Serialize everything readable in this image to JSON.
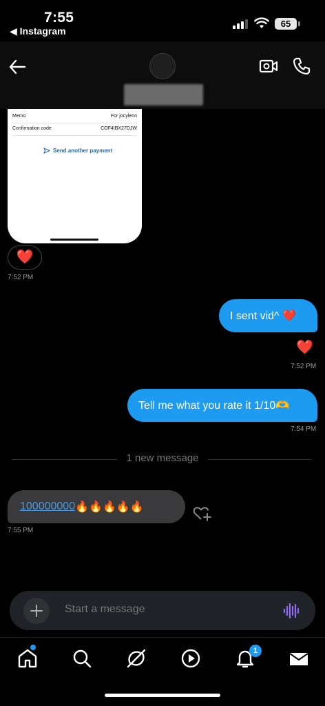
{
  "status_bar": {
    "time": "7:55",
    "back_app": "◀ Instagram",
    "battery": "65"
  },
  "header": {
    "icons": [
      "back-arrow-icon",
      "video-camera-icon",
      "phone-icon"
    ]
  },
  "shared_card": {
    "rows": [
      {
        "label": "Memo",
        "value": "For jocylenn"
      },
      {
        "label": "Confirmation code",
        "value": "COF4IBX27DJW"
      }
    ],
    "action": "Send another payment"
  },
  "messages": {
    "card_reaction": "❤️",
    "card_time": "7:52 PM",
    "sent_1": "I sent vid^ ❤️",
    "heart_reaction": "❤️",
    "sent_1_time": "7:52 PM",
    "sent_2": "Tell me what you rate it 1/10🫶",
    "sent_2_time": "7:54 PM",
    "new_divider": "1 new message",
    "recv_link": "100000000",
    "recv_emoji": "🔥🔥🔥🔥🔥",
    "recv_time": "7:55 PM"
  },
  "composer": {
    "placeholder": "Start a message"
  },
  "nav": {
    "notifications_count": "1"
  },
  "colors": {
    "accent": "#1d9bf0",
    "incoming": "#3a3a3c",
    "background": "#000000"
  }
}
